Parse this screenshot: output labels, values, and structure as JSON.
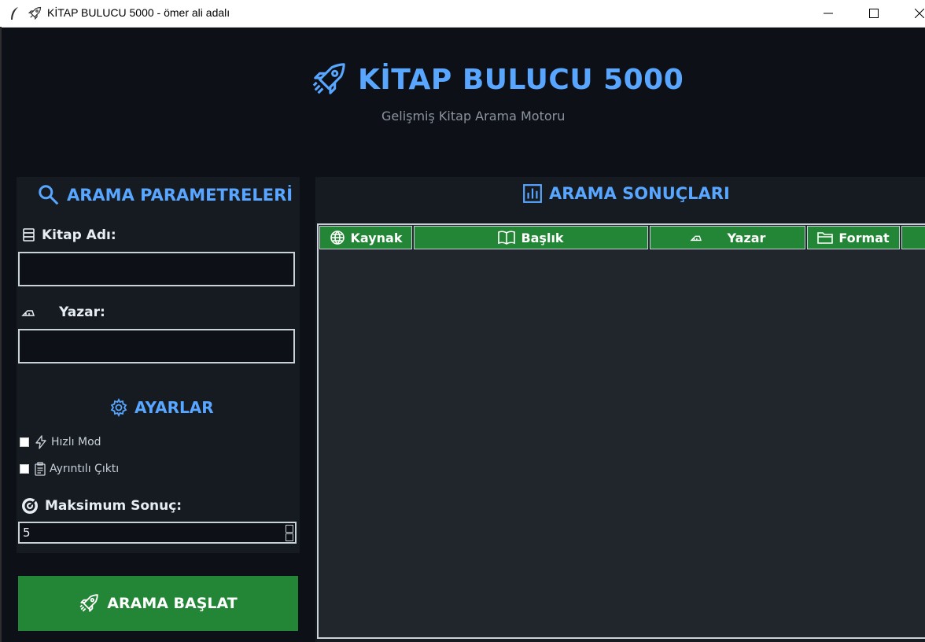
{
  "window": {
    "title": "KİTAP BULUCU 5000 - ömer ali adalı",
    "controls": [
      "minimize",
      "maximize",
      "close"
    ]
  },
  "header": {
    "title": "KİTAP BULUCU 5000",
    "subtitle": "Gelişmiş Kitap Arama Motoru",
    "icon": "rocket-icon"
  },
  "search_panel": {
    "title": "ARAMA PARAMETRELERİ",
    "book_name_label": "Kitap Adı:",
    "book_name_value": "",
    "author_label": "Yazar:",
    "author_value": "",
    "settings_title": "AYARLAR",
    "fast_mode_label": "Hızlı Mod",
    "fast_mode_checked": false,
    "verbose_label": "Ayrıntılı Çıktı",
    "verbose_checked": false,
    "max_results_label": "Maksimum Sonuç:",
    "max_results_value": "5"
  },
  "search_button": {
    "label": "ARAMA BAŞLAT"
  },
  "results_panel": {
    "title": "ARAMA SONUÇLARI",
    "columns": [
      {
        "label": "Kaynak",
        "icon": "globe-icon"
      },
      {
        "label": "Başlık",
        "icon": "book-icon"
      },
      {
        "label": "Yazar",
        "icon": "writing-hand-icon"
      },
      {
        "label": "Format",
        "icon": "folder-icon"
      }
    ],
    "rows": []
  },
  "colors": {
    "background": "#0d1117",
    "panel": "#161b22",
    "accent_blue": "#58a6ff",
    "accent_green": "#238636",
    "results_bg": "#21262d"
  }
}
